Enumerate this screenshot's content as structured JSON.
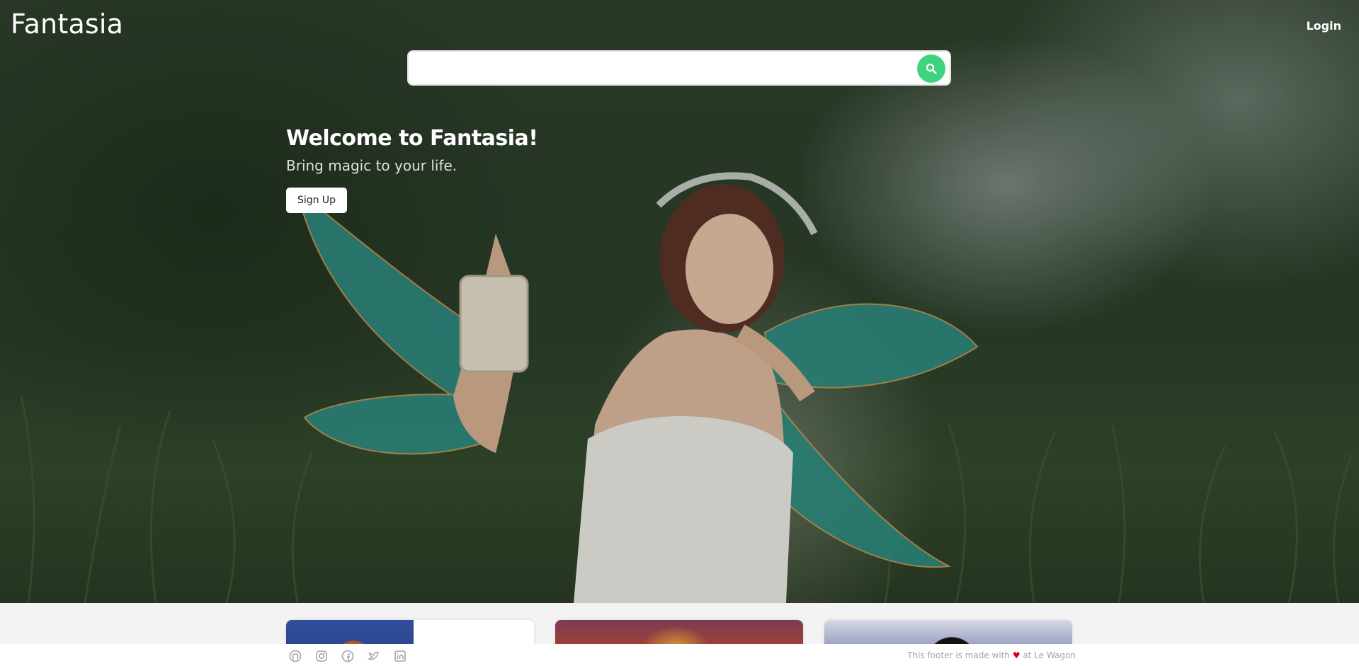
{
  "navbar": {
    "brand": "Fantasia",
    "login_label": "Login"
  },
  "search": {
    "value": "",
    "placeholder": "",
    "button_icon": "search-icon"
  },
  "hero": {
    "title": "Welcome to Fantasia!",
    "subtitle": "Bring magic to your life.",
    "signup_label": "Sign Up",
    "background_image": "fairy with teal wings holding a birdcage in a misty forest"
  },
  "cards": [
    {
      "image": "redhead portrait on blue background"
    },
    {
      "image": "warrior silhouette against a sunset sky"
    },
    {
      "image": "dark figure on a pale purple background"
    }
  ],
  "footer": {
    "social_icons": [
      "github-icon",
      "instagram-icon",
      "facebook-icon",
      "twitter-icon",
      "linkedin-icon"
    ],
    "note_prefix": "This footer is made with",
    "heart": "♥",
    "note_suffix": "at Le Wagon"
  },
  "colors": {
    "search_button": "#3ed47d",
    "heart": "#d1001f",
    "footer_text": "#a4a4a4"
  }
}
